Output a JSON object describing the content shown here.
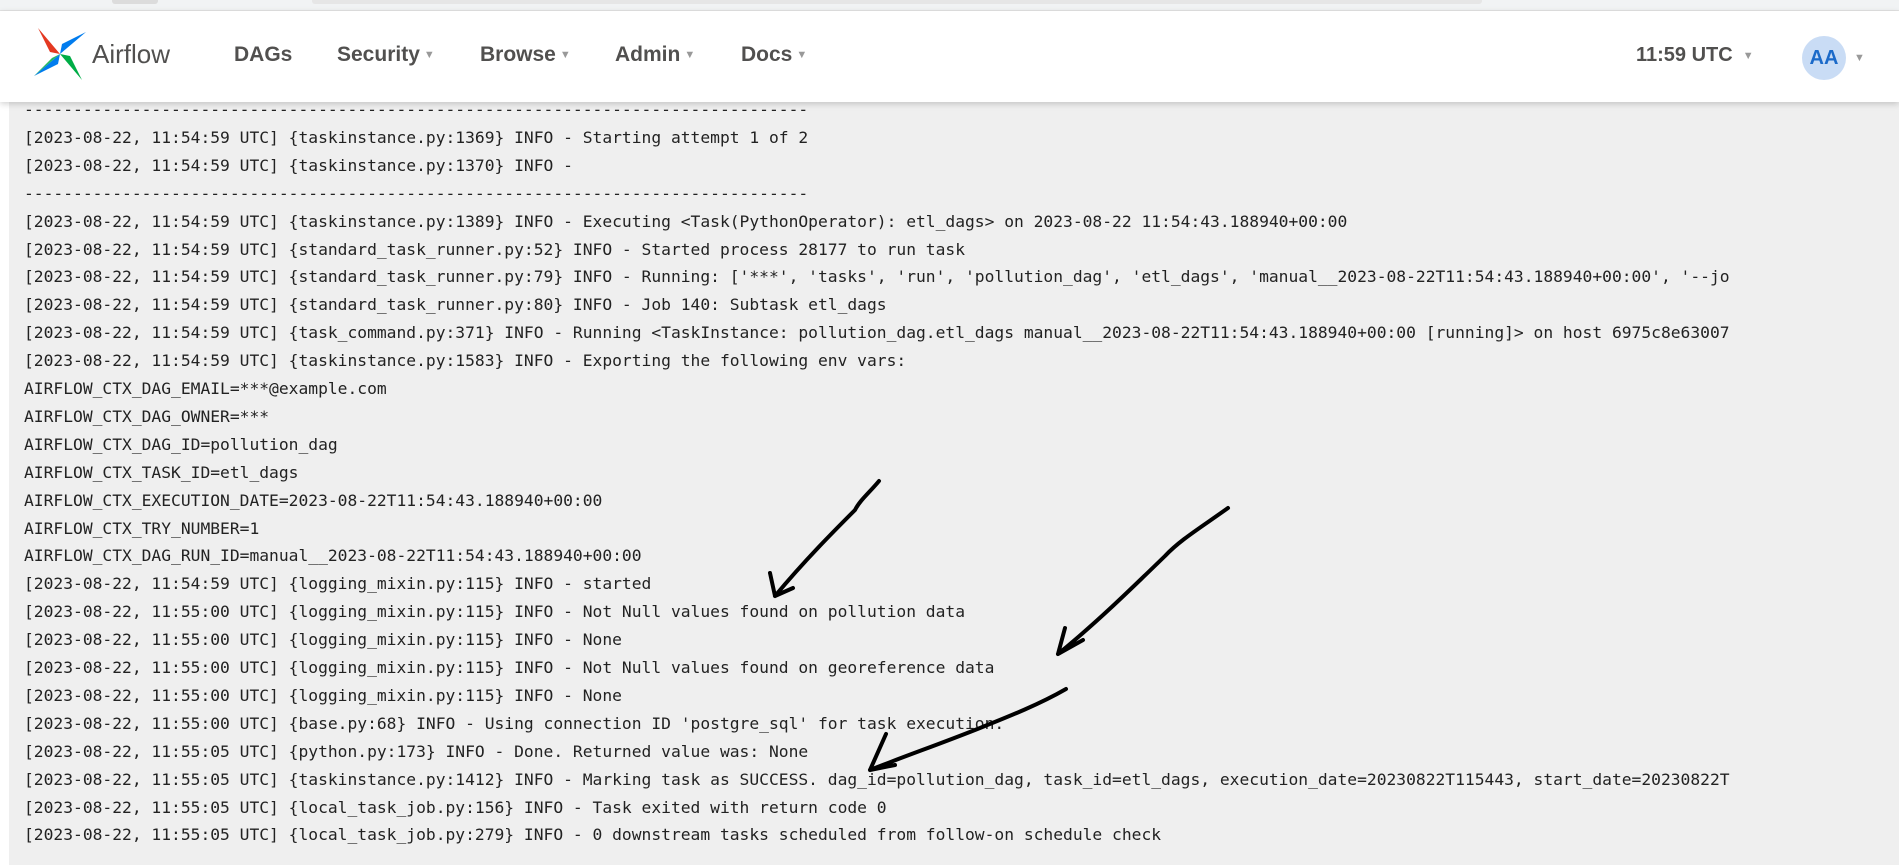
{
  "navbar": {
    "brand": "Airflow",
    "menu": [
      {
        "label": "DAGs"
      },
      {
        "label": "Security"
      },
      {
        "label": "Browse"
      },
      {
        "label": "Admin"
      },
      {
        "label": "Docs"
      }
    ],
    "time": "11:59 UTC",
    "avatar_initials": "AA",
    "logo_colors": [
      "#e43921",
      "#00ad46",
      "#017cee",
      "#04d659"
    ]
  },
  "log": {
    "lines": [
      "--------------------------------------------------------------------------------",
      "[2023-08-22, 11:54:59 UTC] {taskinstance.py:1369} INFO - Starting attempt 1 of 2",
      "[2023-08-22, 11:54:59 UTC] {taskinstance.py:1370} INFO -",
      "--------------------------------------------------------------------------------",
      "[2023-08-22, 11:54:59 UTC] {taskinstance.py:1389} INFO - Executing <Task(PythonOperator): etl_dags> on 2023-08-22 11:54:43.188940+00:00",
      "[2023-08-22, 11:54:59 UTC] {standard_task_runner.py:52} INFO - Started process 28177 to run task",
      "[2023-08-22, 11:54:59 UTC] {standard_task_runner.py:79} INFO - Running: ['***', 'tasks', 'run', 'pollution_dag', 'etl_dags', 'manual__2023-08-22T11:54:43.188940+00:00', '--jo",
      "[2023-08-22, 11:54:59 UTC] {standard_task_runner.py:80} INFO - Job 140: Subtask etl_dags",
      "[2023-08-22, 11:54:59 UTC] {task_command.py:371} INFO - Running <TaskInstance: pollution_dag.etl_dags manual__2023-08-22T11:54:43.188940+00:00 [running]> on host 6975c8e63007",
      "[2023-08-22, 11:54:59 UTC] {taskinstance.py:1583} INFO - Exporting the following env vars:",
      "AIRFLOW_CTX_DAG_EMAIL=***@example.com",
      "AIRFLOW_CTX_DAG_OWNER=***",
      "AIRFLOW_CTX_DAG_ID=pollution_dag",
      "AIRFLOW_CTX_TASK_ID=etl_dags",
      "AIRFLOW_CTX_EXECUTION_DATE=2023-08-22T11:54:43.188940+00:00",
      "AIRFLOW_CTX_TRY_NUMBER=1",
      "AIRFLOW_CTX_DAG_RUN_ID=manual__2023-08-22T11:54:43.188940+00:00",
      "[2023-08-22, 11:54:59 UTC] {logging_mixin.py:115} INFO - started",
      "[2023-08-22, 11:55:00 UTC] {logging_mixin.py:115} INFO - Not Null values found on pollution data",
      "[2023-08-22, 11:55:00 UTC] {logging_mixin.py:115} INFO - None",
      "[2023-08-22, 11:55:00 UTC] {logging_mixin.py:115} INFO - Not Null values found on georeference data",
      "[2023-08-22, 11:55:00 UTC] {logging_mixin.py:115} INFO - None",
      "[2023-08-22, 11:55:00 UTC] {base.py:68} INFO - Using connection ID 'postgre_sql' for task execution.",
      "[2023-08-22, 11:55:05 UTC] {python.py:173} INFO - Done. Returned value was: None",
      "[2023-08-22, 11:55:05 UTC] {taskinstance.py:1412} INFO - Marking task as SUCCESS. dag_id=pollution_dag, task_id=etl_dags, execution_date=20230822T115443, start_date=20230822T",
      "[2023-08-22, 11:55:05 UTC] {local_task_job.py:156} INFO - Task exited with return code 0",
      "[2023-08-22, 11:55:05 UTC] {local_task_job.py:279} INFO - 0 downstream tasks scheduled from follow-on schedule check"
    ]
  }
}
